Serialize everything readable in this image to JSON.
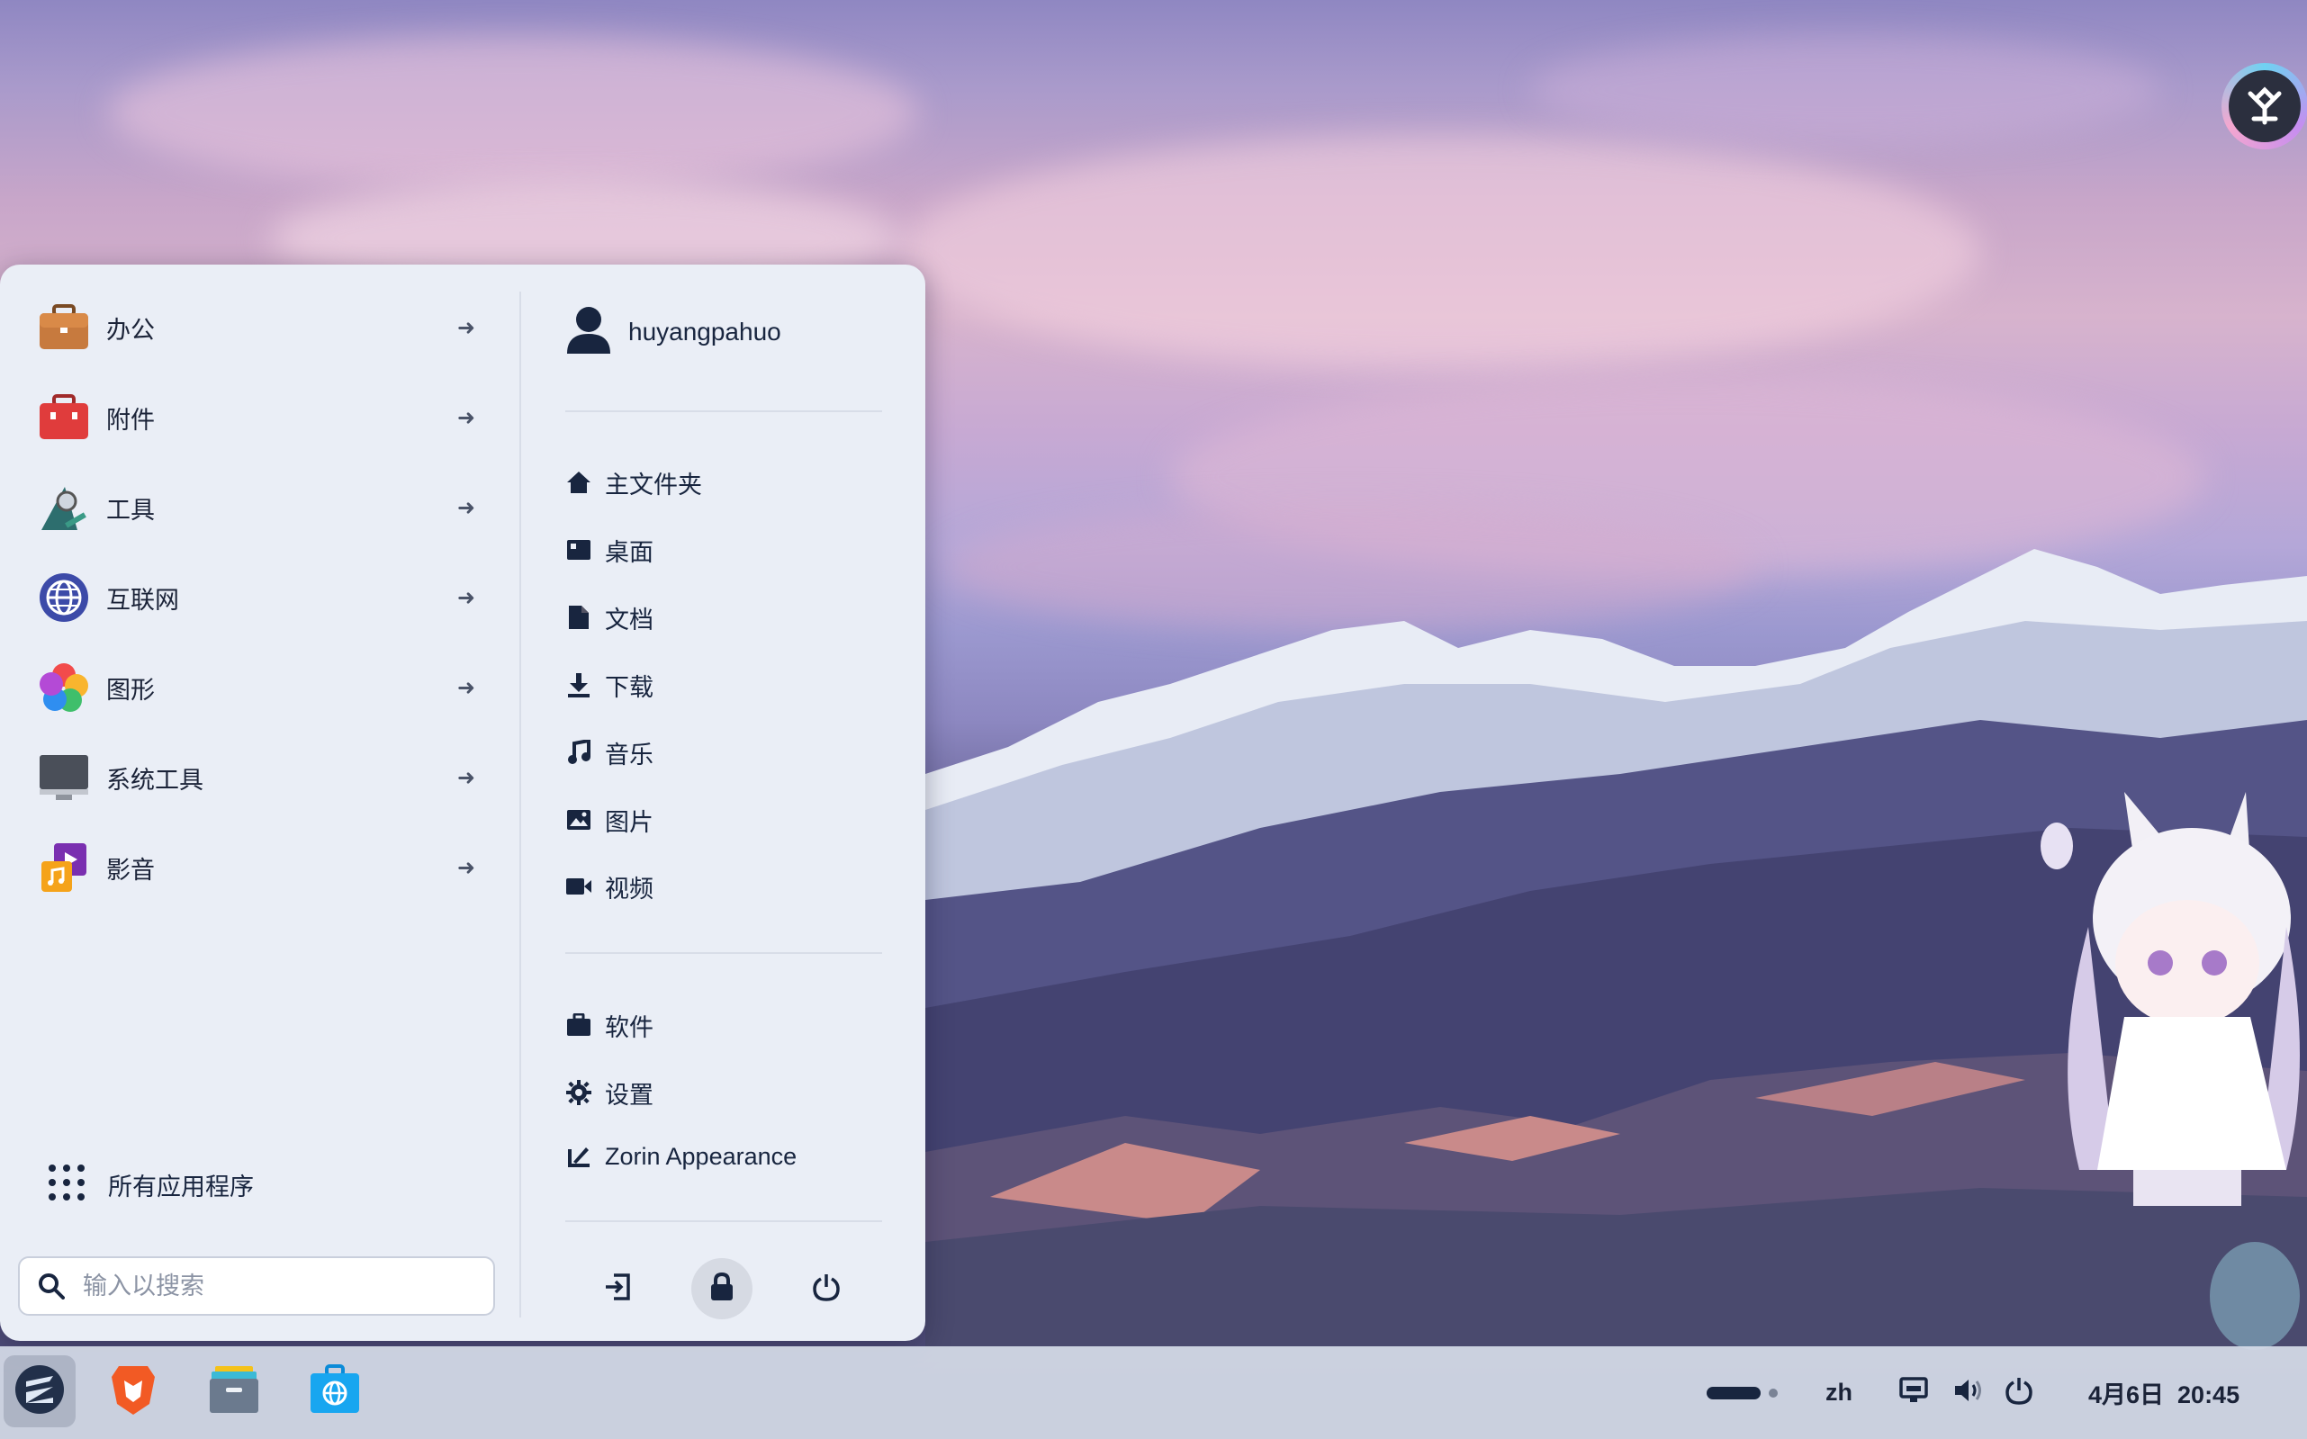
{
  "menu": {
    "categories": [
      {
        "label": "办公",
        "icon": "briefcase-icon"
      },
      {
        "label": "附件",
        "icon": "toolbox-icon"
      },
      {
        "label": "工具",
        "icon": "tools-icon"
      },
      {
        "label": "互联网",
        "icon": "globe-icon"
      },
      {
        "label": "图形",
        "icon": "graphics-icon"
      },
      {
        "label": "系统工具",
        "icon": "monitor-icon"
      },
      {
        "label": "影音",
        "icon": "media-icon"
      }
    ],
    "user": {
      "name": "huyangpahuo",
      "icon": "user-icon"
    },
    "places": [
      {
        "label": "主文件夹",
        "icon": "home-icon"
      },
      {
        "label": "桌面",
        "icon": "desktop-icon"
      },
      {
        "label": "文档",
        "icon": "document-icon"
      },
      {
        "label": "下载",
        "icon": "download-icon"
      },
      {
        "label": "音乐",
        "icon": "music-icon"
      },
      {
        "label": "图片",
        "icon": "image-icon"
      },
      {
        "label": "视频",
        "icon": "video-icon"
      }
    ],
    "system": [
      {
        "label": "软件",
        "icon": "software-icon"
      },
      {
        "label": "设置",
        "icon": "gear-icon"
      },
      {
        "label": "Zorin Appearance",
        "icon": "appearance-icon"
      }
    ],
    "all_apps_label": "所有应用程序",
    "search": {
      "placeholder": "输入以搜索",
      "value": ""
    },
    "power_buttons": [
      "logout-icon",
      "lock-icon",
      "power-icon"
    ]
  },
  "taskbar": {
    "apps": [
      "zorin-menu-icon",
      "brave-browser-icon",
      "file-manager-icon",
      "software-store-icon"
    ],
    "input_method": "zh",
    "clock": "4月6日  20:45"
  },
  "colors": {
    "menu_bg": "#eaeef6",
    "text": "#18253f",
    "taskbar_bg": "#d6dce8"
  }
}
